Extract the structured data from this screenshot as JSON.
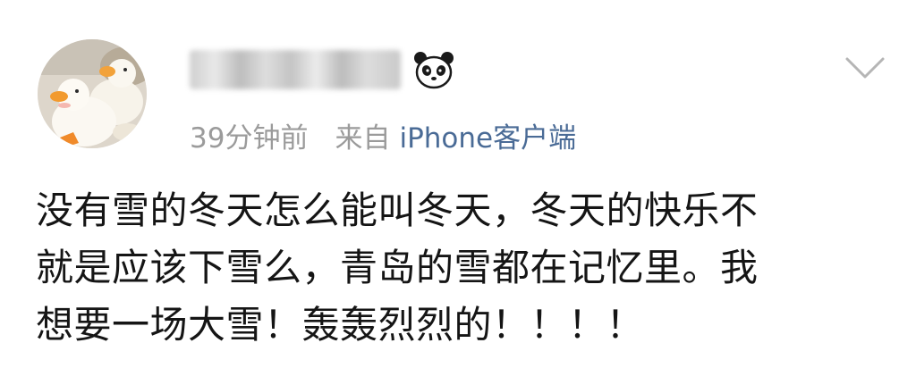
{
  "post": {
    "author": {
      "avatar_icon": "avatar-duck-plush-image",
      "name_blurred": true,
      "badge_icon": "panda-badge-icon"
    },
    "menu_icon": "chevron-down-icon",
    "meta": {
      "time": "39分钟前",
      "source_prefix": "来自",
      "source": "iPhone客户端"
    },
    "content_lines": [
      "没有雪的冬天怎么能叫冬天，冬天的快乐不",
      "就是应该下雪么，青岛的雪都在记忆里。我",
      "想要一场大雪！轰轰烈烈的！！！！"
    ],
    "colors": {
      "meta_text": "#9b9b9b",
      "source_link": "#4a6b96",
      "body_text": "#151515"
    }
  }
}
